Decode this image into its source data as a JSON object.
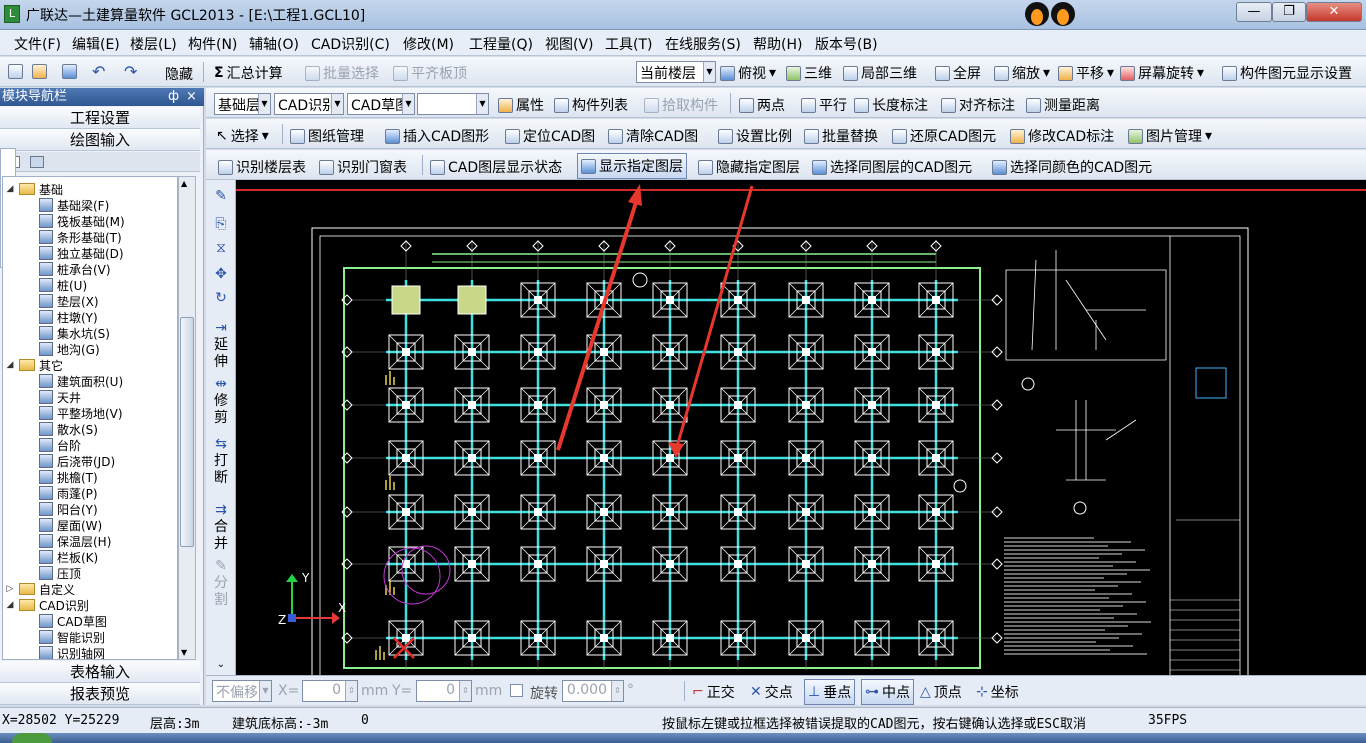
{
  "window": {
    "title": "广联达—土建算量软件 GCL2013 - [E:\\工程1.GCL10]",
    "min": "—",
    "max": "❐",
    "close": "✕"
  },
  "menu": [
    "文件(F)",
    "编辑(E)",
    "楼层(L)",
    "构件(N)",
    "辅轴(O)",
    "CAD识别(C)",
    "修改(M)",
    "工程量(Q)",
    "视图(V)",
    "工具(T)",
    "在线服务(S)",
    "帮助(H)",
    "版本号(B)"
  ],
  "toolbar1": {
    "hide": "隐藏",
    "sum_calc": "汇总计算",
    "batch_select": "批量选择",
    "flush_slab": "平齐板顶",
    "floor_combo": "当前楼层",
    "view_top": "俯视",
    "view_3d": "三维",
    "local_3d": "局部三维",
    "fullscreen": "全屏",
    "zoom": "缩放",
    "pan": "平移",
    "rotate": "屏幕旋转",
    "display_settings": "构件图元显示设置"
  },
  "toolbar2": {
    "combo1": "基础层",
    "combo2": "CAD识别",
    "combo3": "CAD草图",
    "combo4": "",
    "props": "属性",
    "list": "构件列表",
    "pick": "拾取构件",
    "two_points": "两点",
    "parallel": "平行",
    "len_dim": "长度标注",
    "align_dim": "对齐标注",
    "measure": "测量距离"
  },
  "toolbar3": {
    "select": "选择",
    "drawing_mgr": "图纸管理",
    "insert_cad": "插入CAD图形",
    "locate_cad": "定位CAD图",
    "clear_cad": "清除CAD图",
    "set_scale": "设置比例",
    "batch_replace": "批量替换",
    "restore_cad": "还原CAD图元",
    "modify_cad_dim": "修改CAD标注",
    "img_mgr": "图片管理"
  },
  "toolbar4": {
    "identify_floors": "识别楼层表",
    "identify_doors": "识别门窗表",
    "layer_status": "CAD图层显示状态",
    "show_layer": "显示指定图层",
    "hide_layer": "隐藏指定图层",
    "select_same_layer": "选择同图层的CAD图元",
    "select_same_color": "选择同颜色的CAD图元"
  },
  "panel": {
    "header": "模块导航栏",
    "pin": "ф",
    "close": "×",
    "project_settings": "工程设置",
    "drawing_input": "绘图输入",
    "table_input": "表格输入",
    "report_preview": "报表预览"
  },
  "tree": [
    {
      "label": "基础",
      "kind": "folder",
      "level": 1,
      "exp": "◢"
    },
    {
      "label": "基础梁(F)",
      "kind": "item",
      "level": 2
    },
    {
      "label": "筏板基础(M)",
      "kind": "item",
      "level": 2
    },
    {
      "label": "条形基础(T)",
      "kind": "item",
      "level": 2
    },
    {
      "label": "独立基础(D)",
      "kind": "item",
      "level": 2
    },
    {
      "label": "桩承台(V)",
      "kind": "item",
      "level": 2
    },
    {
      "label": "桩(U)",
      "kind": "item",
      "level": 2
    },
    {
      "label": "垫层(X)",
      "kind": "item",
      "level": 2
    },
    {
      "label": "柱墩(Y)",
      "kind": "item",
      "level": 2
    },
    {
      "label": "集水坑(S)",
      "kind": "item",
      "level": 2
    },
    {
      "label": "地沟(G)",
      "kind": "item",
      "level": 2
    },
    {
      "label": "其它",
      "kind": "folder",
      "level": 1,
      "exp": "◢"
    },
    {
      "label": "建筑面积(U)",
      "kind": "item",
      "level": 2
    },
    {
      "label": "天井",
      "kind": "item",
      "level": 2
    },
    {
      "label": "平整场地(V)",
      "kind": "item",
      "level": 2
    },
    {
      "label": "散水(S)",
      "kind": "item",
      "level": 2
    },
    {
      "label": "台阶",
      "kind": "item",
      "level": 2
    },
    {
      "label": "后浇带(JD)",
      "kind": "item",
      "level": 2
    },
    {
      "label": "挑檐(T)",
      "kind": "item",
      "level": 2
    },
    {
      "label": "雨蓬(P)",
      "kind": "item",
      "level": 2
    },
    {
      "label": "阳台(Y)",
      "kind": "item",
      "level": 2
    },
    {
      "label": "屋面(W)",
      "kind": "item",
      "level": 2
    },
    {
      "label": "保温层(H)",
      "kind": "item",
      "level": 2
    },
    {
      "label": "栏板(K)",
      "kind": "item",
      "level": 2
    },
    {
      "label": "压顶",
      "kind": "item",
      "level": 2
    },
    {
      "label": "自定义",
      "kind": "folder",
      "level": 1,
      "exp": "▷"
    },
    {
      "label": "CAD识别",
      "kind": "folder",
      "level": 1,
      "exp": "◢"
    },
    {
      "label": "CAD草图",
      "kind": "item",
      "level": 2
    },
    {
      "label": "智能识别",
      "kind": "item",
      "level": 2
    },
    {
      "label": "识别轴网",
      "kind": "item",
      "level": 2
    }
  ],
  "vtools": {
    "extend": "延伸",
    "trim": "修剪",
    "break": "打断",
    "merge": "合并",
    "split": "分割"
  },
  "cmdbar": {
    "ortho_combo": "不偏移",
    "x_label": "X=",
    "x_val": "0",
    "mm1": "mm",
    "y_label": "Y=",
    "y_val": "0",
    "mm2": "mm",
    "rotate": "旋转",
    "rot_val": "0.000",
    "deg": "°",
    "ortho": "正交",
    "intersect": "交点",
    "perp": "垂点",
    "mid": "中点",
    "vertex": "顶点",
    "coord": "坐标"
  },
  "status": {
    "xy": "X=28502 Y=25229",
    "floor_height": "层高:3m",
    "base_elev": "建筑底标高:-3m",
    "zero": "0",
    "hint": "按鼠标左键或拉框选择被错误提取的CAD图元，按右键确认选择或ESC取消",
    "fps": "35FPS"
  },
  "canvas": {
    "axis_y": "Y",
    "axis_x": "X",
    "axis_z": "Z"
  },
  "colors": {
    "grid_line": "#3fe0e0",
    "column": "#ffffff",
    "border": "#8cf18c",
    "arrow": "#e8382e",
    "canvas_bg": "#000000"
  }
}
